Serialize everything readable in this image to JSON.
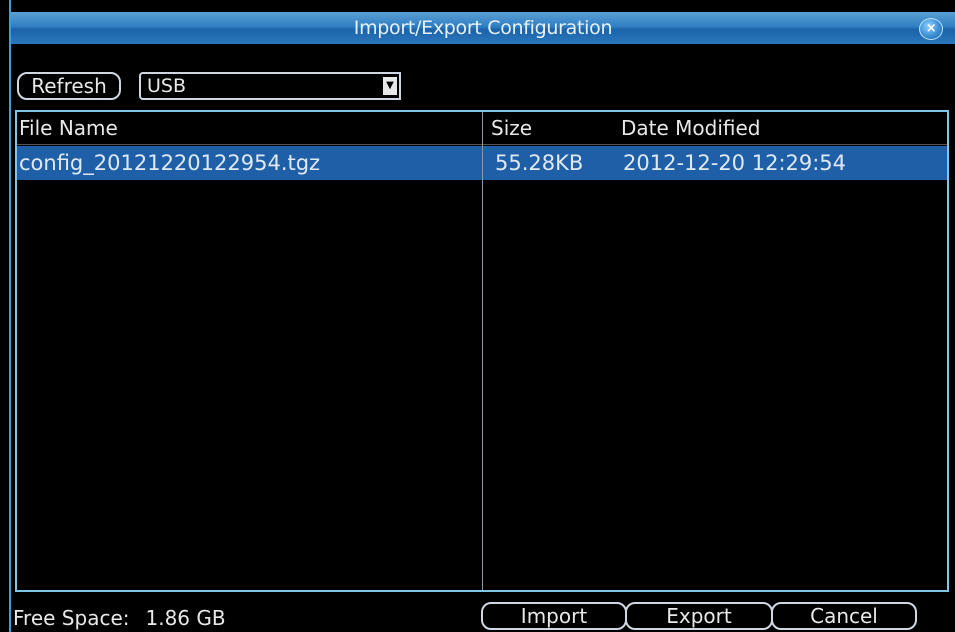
{
  "window": {
    "title": "Import/Export Configuration",
    "close_label": "×"
  },
  "toolbar": {
    "refresh_label": "Refresh",
    "device_select": {
      "selected": "USB",
      "arrow": "▼"
    }
  },
  "table": {
    "columns": [
      "File Name",
      "Size",
      "Date Modified"
    ],
    "rows": [
      {
        "name": "config_20121220122954.tgz",
        "size": "55.28KB",
        "date": "2012-12-20 12:29:54",
        "selected": true
      }
    ]
  },
  "footer": {
    "free_space_label": "Free Space:",
    "free_space_value": "1.86 GB",
    "import_label": "Import",
    "export_label": "Export",
    "cancel_label": "Cancel"
  },
  "colors": {
    "titlebar": "#2f7fc3",
    "selection": "#1f5fa8",
    "frame": "#7ec6e6",
    "background": "#000000"
  }
}
